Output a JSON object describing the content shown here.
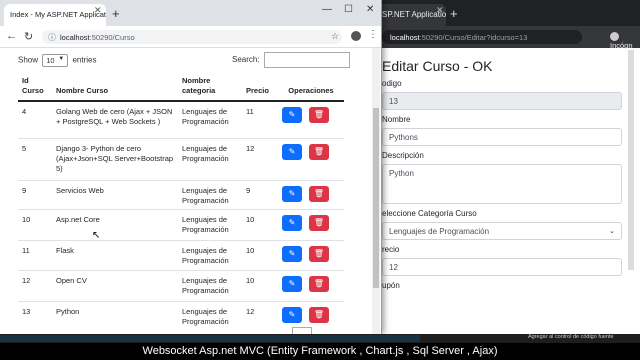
{
  "right_window": {
    "tab_title": "SP.NET Application",
    "url_host": "localhost",
    "url_path": ":50290/Curso/Editar?idcurso=13",
    "profile_label": "Incógn",
    "form": {
      "title": "Editar Curso - OK",
      "codigo_label": "odigo",
      "codigo_value": "13",
      "nombre_label": "Nombre",
      "nombre_value": "Pythons",
      "descripcion_label": "Descripción",
      "descripcion_value": "Python",
      "categoria_label": "eleccione Categoría Curso",
      "categoria_value": "Lenguajes de Programación",
      "precio_label": "recio",
      "precio_value": "12",
      "cupon_label": "upón"
    }
  },
  "left_window": {
    "tab_title": "Index - My ASP.NET Application",
    "url_host": "localhost",
    "url_path": ":50290/Curso",
    "show_label": "Show",
    "entries_value": "10",
    "entries_label": "entries",
    "search_label": "Search:",
    "columns": [
      "Id Curso",
      "Nombre Curso",
      "Nombre categoria",
      "Precio",
      "Operaciones"
    ],
    "rows": [
      {
        "id": "4",
        "nombre": "Golang Web de cero (Ajax + JSON + PostgreSQL + Web Sockets )",
        "categoria": "Lenguajes de Programación",
        "precio": "11"
      },
      {
        "id": "5",
        "nombre": "Django 3- Python de cero (Ajax+Json+SQL Server+Bootstrap 5)",
        "categoria": "Lenguajes de Programación",
        "precio": "12"
      },
      {
        "id": "9",
        "nombre": "Servicios Web",
        "categoria": "Lenguajes de Programación",
        "precio": "9"
      },
      {
        "id": "10",
        "nombre": "Asp.net Core",
        "categoria": "Lenguajes de Programación",
        "precio": "10"
      },
      {
        "id": "11",
        "nombre": "Flask",
        "categoria": "Lenguajes de Programación",
        "precio": "10"
      },
      {
        "id": "12",
        "nombre": "Open CV",
        "categoria": "Lenguajes de Programación",
        "precio": "10"
      },
      {
        "id": "13",
        "nombre": "Python",
        "categoria": "Lenguajes de Programación",
        "precio": "12"
      }
    ]
  },
  "taskbar_note": "Agregar al control de código fuente",
  "caption": "Websocket Asp.net MVC (Entity Framework , Chart.js , Sql Server , Ajax)",
  "icons": {
    "edit": "pencil-icon",
    "delete": "trash-icon"
  },
  "colors": {
    "edit_button": "#0d6efd",
    "delete_button": "#dc3545"
  }
}
